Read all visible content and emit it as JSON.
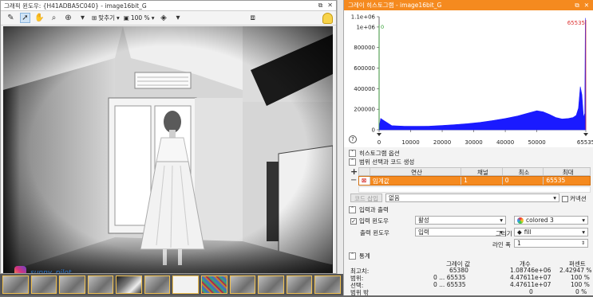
{
  "image_window": {
    "title": "그래픽 윈도우: {H41ADBA5C040} - image16bit_G",
    "fit_label": "맞추기",
    "zoom": "100 %",
    "watermark": "sunny_pilot"
  },
  "histogram_window": {
    "title": "그레이 히스토그램 - image16bit_G",
    "chart": {
      "y_top_labels": [
        "1.1e+06",
        "1e+06"
      ],
      "y_tick_labels": [
        "800000",
        "600000",
        "400000",
        "200000",
        "0"
      ],
      "x_tick_labels": [
        "0",
        "10000",
        "20000",
        "30000",
        "40000",
        "50000",
        "65535"
      ],
      "max_marker": "65535",
      "min_marker": "0"
    },
    "sections": {
      "options": "히스토그램 옵션",
      "range": "범위 선택과 코드 생성",
      "io": "입력과 출력",
      "stats": "통계"
    },
    "table": {
      "headers": [
        "",
        "연산",
        "채널",
        "최소",
        "최대"
      ],
      "row": {
        "op": "임계값",
        "channel": "1",
        "min": "0",
        "max": "65535"
      }
    },
    "code_insert_label": "코드 삽입",
    "code_select": "없음",
    "connect_label": "커넥션",
    "input_window_label": "입력 윈도우",
    "input_window_value": "활성",
    "output_window_label": "출력 윈도우",
    "output_window_value": "입력",
    "color_label": "색상",
    "color_value": "colored 3",
    "draw_label": "그리기",
    "draw_value": "fill",
    "line_width_label": "라인 폭",
    "line_width_value": "1",
    "stats": {
      "headers": [
        "그레이 값",
        "개수",
        "퍼센트"
      ],
      "rows": [
        {
          "name": "최고치:",
          "gray": "65380",
          "count": "1.08746e+06",
          "pct": "2.42947 %"
        },
        {
          "name": "범위:",
          "gray": "0 ... 65535",
          "count": "4.47611e+07",
          "pct": "100 %"
        },
        {
          "name": "선택:",
          "gray": "0 ... 65535",
          "count": "4.47611e+07",
          "pct": "100 %"
        },
        {
          "name": "범위 밖",
          "gray": "",
          "count": "0",
          "pct": "0 %"
        }
      ]
    }
  },
  "chart_data": {
    "type": "area",
    "title": "",
    "xlabel": "",
    "ylabel": "",
    "xlim": [
      0,
      65535
    ],
    "ylim": [
      0,
      1100000
    ],
    "x": [
      0,
      500,
      1500,
      4000,
      8000,
      12000,
      16000,
      20000,
      24000,
      28000,
      32000,
      36000,
      40000,
      44000,
      47000,
      50000,
      52000,
      54000,
      56000,
      58000,
      60000,
      61500,
      62500,
      63200,
      63800,
      64300,
      64800,
      65200,
      65380,
      65535
    ],
    "values": [
      20000,
      110000,
      90000,
      40000,
      35000,
      34000,
      36000,
      42000,
      50000,
      60000,
      72000,
      90000,
      110000,
      135000,
      160000,
      185000,
      175000,
      150000,
      120000,
      105000,
      110000,
      120000,
      140000,
      210000,
      420000,
      340000,
      120000,
      160000,
      1087460,
      60000
    ],
    "color": "#1a1aff"
  }
}
